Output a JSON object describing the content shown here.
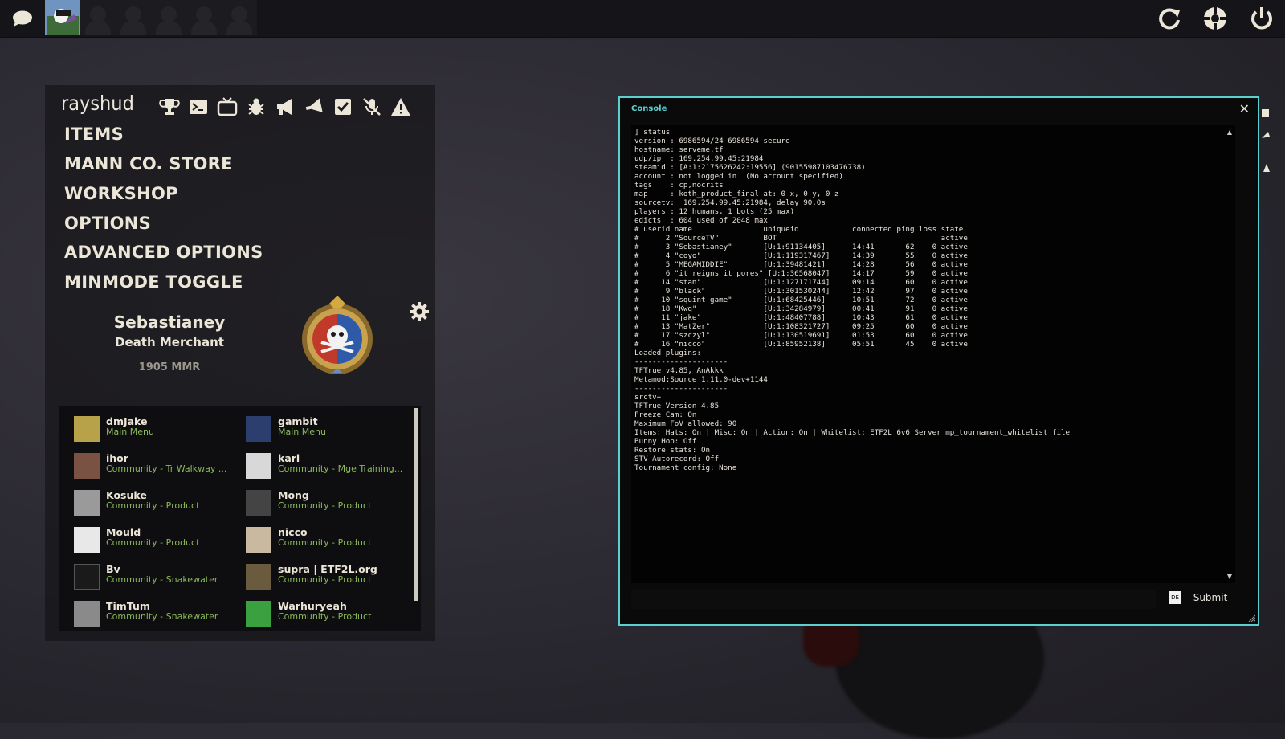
{
  "colors": {
    "accent": "#5bd0d0",
    "status_green": "#8ab85a",
    "text": "#ece6d8",
    "mmr": "#9b968c"
  },
  "topbar": {
    "left_icons": [
      "chat-icon"
    ],
    "party_slots": 6,
    "right_icons": [
      "refresh-icon",
      "achievements-icon",
      "quit-icon"
    ]
  },
  "menu": {
    "hud_name": "rayshud",
    "icons": [
      "trophy-icon",
      "terminal-icon",
      "tv-icon",
      "bug-icon",
      "megaphone-icon",
      "megaphone-2-icon",
      "checkbox-icon",
      "mute-mic-icon",
      "warning-icon"
    ],
    "items": [
      "ITEMS",
      "MANN CO. STORE",
      "WORKSHOP",
      "OPTIONS",
      "ADVANCED OPTIONS",
      "MINMODE TOGGLE"
    ]
  },
  "profile": {
    "name": "Sebastianey",
    "title": "Death Merchant",
    "mmr": "1905 MMR"
  },
  "friends": [
    {
      "name": "dmJake",
      "status": "Main Menu",
      "pic": "#b7a24a"
    },
    {
      "name": "gambit",
      "status": "Main Menu",
      "pic": "#2c3e6e"
    },
    {
      "name": "ihor",
      "status": "Community - Tr Walkway ...",
      "pic": "#7a5244"
    },
    {
      "name": "karl",
      "status": "Community - Mge Training...",
      "pic": "#d8d8d8"
    },
    {
      "name": "Kosuke",
      "status": "Community - Product",
      "pic": "#9a9a9a"
    },
    {
      "name": "Mong",
      "status": "Community - Product",
      "pic": "#444444"
    },
    {
      "name": "Mould",
      "status": "Community - Product",
      "pic": "#e8e8e8"
    },
    {
      "name": "nicco",
      "status": "Community - Product",
      "pic": "#c9b9a0"
    },
    {
      "name": "Bv",
      "status": "Community - Snakewater",
      "pic": "#1a1a1a"
    },
    {
      "name": "supra | ETF2L.org",
      "status": "Community - Product",
      "pic": "#6a5b3e"
    },
    {
      "name": "TimTum",
      "status": "Community - Snakewater",
      "pic": "#8a8a8a"
    },
    {
      "name": "Warhuryeah",
      "status": "Community - Product",
      "pic": "#3aa040"
    }
  ],
  "console": {
    "title": "Console",
    "close": "✕",
    "lines": [
      "] status",
      "version : 6986594/24 6986594 secure",
      "hostname: serveme.tf",
      "udp/ip  : 169.254.99.45:21984",
      "steamid : [A:1:2175626242:19556] (90155987103476738)",
      "account : not logged in  (No account specified)",
      "tags    : cp,nocrits",
      "map     : koth_product_final at: 0 x, 0 y, 0 z",
      "sourcetv:  169.254.99.45:21984, delay 90.0s",
      "players : 12 humans, 1 bots (25 max)",
      "edicts  : 604 used of 2048 max",
      "# userid name                uniqueid            connected ping loss state",
      "#      2 \"SourceTV\"          BOT                                     active",
      "#      3 \"Sebastianey\"       [U:1:91134405]      14:41       62    0 active",
      "#      4 \"coyo\"              [U:1:119317467]     14:39       55    0 active",
      "#      5 \"MEGAMIDDIE\"        [U:1:39481421]      14:28       56    0 active",
      "#      6 \"it reigns it pores\" [U:1:36568047]     14:17       59    0 active",
      "#     14 \"stan\"              [U:1:127171744]     09:14       60    0 active",
      "#      9 \"black\"             [U:1:301530244]     12:42       97    0 active",
      "#     10 \"squint game\"       [U:1:68425446]      10:51       72    0 active",
      "#     18 \"Kwq\"               [U:1:34284979]      00:41       91    0 active",
      "#     11 \"jake\"              [U:1:48407788]      10:43       61    0 active",
      "#     13 \"MatZer\"            [U:1:108321727]     09:25       60    0 active",
      "#     17 \"szczyl\"            [U:1:130519691]     01:53       60    0 active",
      "#     16 \"nicco\"             [U:1:85952138]      05:51       45    0 active",
      "Loaded plugins:",
      "---------------------",
      "TFTrue v4.85, AnAkkk",
      "Metamod:Source 1.11.0-dev+1144",
      "---------------------",
      "srctv+",
      "TFTrue Version 4.85",
      "Freeze Cam: On",
      "Maximum FoV allowed: 90",
      "Items: Hats: On | Misc: On | Action: On | Whitelist: ETF2L 6v6 Server mp_tournament_whitelist file",
      "Bunny Hop: Off",
      "Restore stats: On",
      "STV Autorecord: Off",
      "Tournament config: None"
    ],
    "input_value": "",
    "lang_badge": "DE",
    "submit_label": "Submit"
  }
}
